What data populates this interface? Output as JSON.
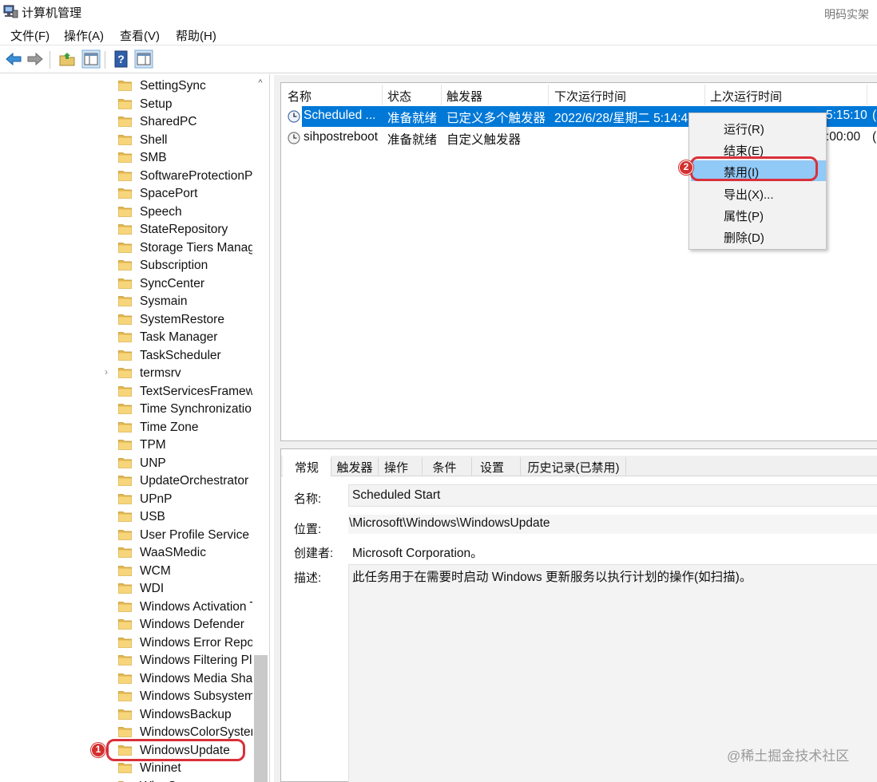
{
  "window": {
    "title": "计算机管理",
    "watermark_top": "明码实架"
  },
  "menubar": [
    "文件(F)",
    "操作(A)",
    "查看(V)",
    "帮助(H)"
  ],
  "toolbar": {
    "icons": [
      "back-arrow-icon",
      "forward-arrow-icon",
      "up-folder-icon",
      "show-hide-tree-icon",
      "help-icon",
      "action-pane-icon"
    ]
  },
  "tree": {
    "items": [
      "SettingSync",
      "Setup",
      "SharedPC",
      "Shell",
      "SMB",
      "SoftwareProtectionP",
      "SpacePort",
      "Speech",
      "StateRepository",
      "Storage Tiers Manag",
      "Subscription",
      "SyncCenter",
      "Sysmain",
      "SystemRestore",
      "Task Manager",
      "TaskScheduler",
      "termsrv",
      "TextServicesFramew",
      "Time Synchronizatio",
      "Time Zone",
      "TPM",
      "UNP",
      "UpdateOrchestrator",
      "UPnP",
      "USB",
      "User Profile Service",
      "WaaSMedic",
      "WCM",
      "WDI",
      "Windows Activation T",
      "Windows Defender",
      "Windows Error Repor",
      "Windows Filtering Pla",
      "Windows Media Shar",
      "Windows Subsystem",
      "WindowsBackup",
      "WindowsColorSysten",
      "WindowsUpdate",
      "Wininet",
      "WlanSvc"
    ],
    "expandable_item": "termsrv",
    "expander_glyph": "›",
    "selected_item": "WindowsUpdate",
    "scroll_up_glyph": "^"
  },
  "task_list": {
    "columns": [
      "名称",
      "状态",
      "触发器",
      "下次运行时间",
      "上次运行时间"
    ],
    "rows": [
      {
        "name": "Scheduled ...",
        "status": "准备就绪",
        "trigger": "已定义多个触发器",
        "next_run": "2022/6/28/星期二 5:14:4",
        "last_run": "5:15:10",
        "result": "(",
        "selected": true
      },
      {
        "name": "sihpostreboot",
        "status": "准备就绪",
        "trigger": "自定义触发器",
        "next_run": "",
        "last_run": ":00:00",
        "result": "(",
        "selected": false
      }
    ]
  },
  "context_menu": {
    "items": [
      "运行(R)",
      "结束(E)",
      "禁用(I)",
      "导出(X)...",
      "属性(P)",
      "删除(D)"
    ],
    "hovered": "禁用(I)"
  },
  "details": {
    "tabs": [
      "常规",
      "触发器",
      "操作",
      "条件",
      "设置",
      "历史记录(已禁用)"
    ],
    "active_tab": "常规",
    "name_label": "名称:",
    "name_value": "Scheduled Start",
    "location_label": "位置:",
    "location_value": "\\Microsoft\\Windows\\WindowsUpdate",
    "author_label": "创建者:",
    "author_value": "Microsoft Corporation。",
    "description_label": "描述:",
    "description_value": "此任务用于在需要时启动 Windows 更新服务以执行计划的操作(如扫描)。"
  },
  "annotations": {
    "badge_1": "1",
    "badge_2": "2",
    "watermark_bottom": "@稀土掘金技术社区",
    "highlight_color": "#d9303a"
  },
  "colors": {
    "selection": "#0078d7",
    "menu_hover": "#91c9f7",
    "badge": "#d32f2f"
  }
}
